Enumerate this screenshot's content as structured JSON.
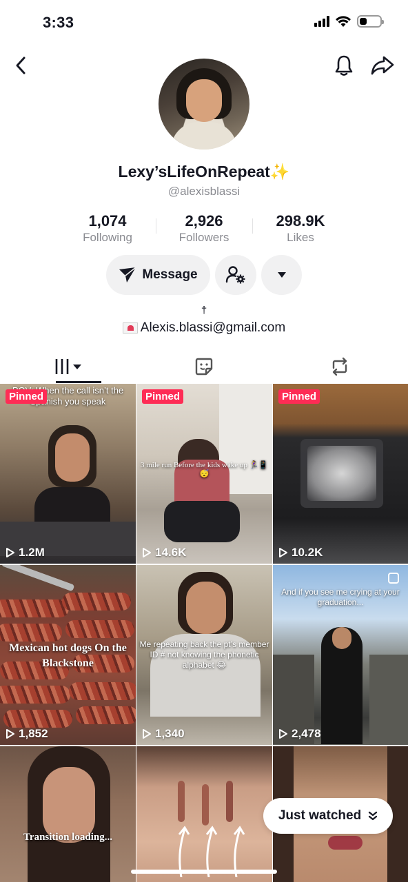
{
  "status_bar": {
    "time": "3:33",
    "battery_level": 0.35
  },
  "header": {
    "back_icon": "chevron-left-icon",
    "bell_icon": "bell-icon",
    "share_icon": "share-arrow-icon"
  },
  "profile": {
    "display_name": "Lexy’sLifeOnRepeat✨",
    "username": "@alexisblassi",
    "stats": [
      {
        "value": "1,074",
        "label": "Following"
      },
      {
        "value": "2,926",
        "label": "Followers"
      },
      {
        "value": "298.9K",
        "label": "Likes"
      }
    ],
    "message_label": "Message",
    "bio_line1": "†",
    "bio_email": "Alexis.blassi@gmail.com"
  },
  "tabs": [
    {
      "name": "videos",
      "icon": "grid-icon"
    },
    {
      "name": "favorites",
      "icon": "sticker-icon"
    },
    {
      "name": "reposts",
      "icon": "repost-icon"
    }
  ],
  "videos": [
    {
      "pinned": "Pinned",
      "views": "1.2M",
      "caption": "POV: When the call isn’t the Spanish you speak"
    },
    {
      "pinned": "Pinned",
      "views": "14.6K",
      "caption": "3 mile run Before the kids wake up 🏃‍♀️📱😴"
    },
    {
      "pinned": "Pinned",
      "views": "10.2K",
      "caption": ""
    },
    {
      "views": "1,852",
      "caption": "Mexican hot dogs On the Blackstone"
    },
    {
      "views": "1,340",
      "caption": "Me repeating back the pt’s member ID # not knowing the phonetic alphabet 😂"
    },
    {
      "views": "2,478",
      "caption": "And if you see me crying at your graduation..."
    },
    {
      "caption": "Transition loading..."
    },
    {
      "caption": ""
    },
    {
      "caption": ""
    }
  ],
  "just_watched": {
    "label": "Just watched",
    "icon": "double-chevron-down-icon"
  },
  "colors": {
    "pinned": "#fe2c55",
    "text": "#161823",
    "muted": "#8a8b91",
    "button_bg": "#f1f1f2"
  }
}
